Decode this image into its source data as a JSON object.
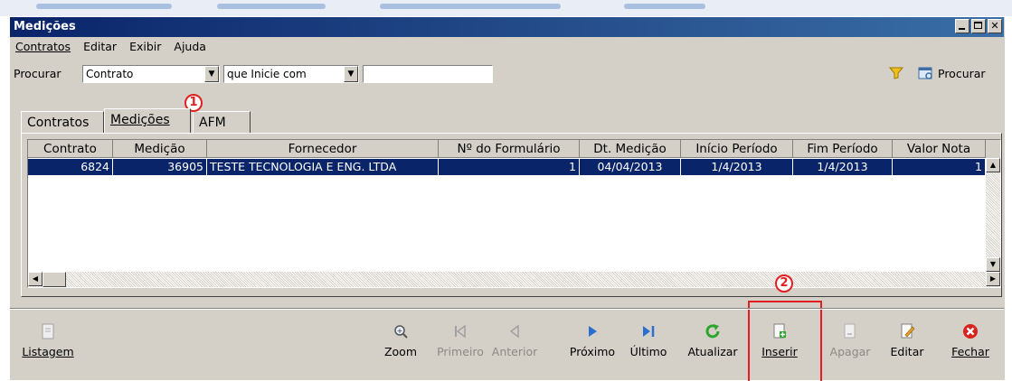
{
  "window": {
    "title": "Medições"
  },
  "menu": [
    {
      "label": "Contratos",
      "id": "menu-contratos"
    },
    {
      "label": "Editar",
      "id": "menu-editar"
    },
    {
      "label": "Exibir",
      "id": "menu-exibir"
    },
    {
      "label": "Ajuda",
      "id": "menu-ajuda"
    }
  ],
  "search": {
    "label": "Procurar",
    "field_value": "Contrato",
    "operator_value": "que Inicie com",
    "text_value": "",
    "button_label": "Procurar"
  },
  "tabs": [
    {
      "label": "Contratos"
    },
    {
      "label": "Medições"
    },
    {
      "label": "AFM"
    }
  ],
  "grid": {
    "columns": [
      "Contrato",
      "Medição",
      "Fornecedor",
      "Nº do Formulário",
      "Dt. Medição",
      "Início Período",
      "Fim Período",
      "Valor Nota"
    ],
    "rows": [
      [
        "6824",
        "36905",
        "TESTE TECNOLOGIA E ENG. LTDA",
        "1",
        "04/04/2013",
        "1/4/2013",
        "1/4/2013",
        "1"
      ]
    ]
  },
  "toolbar": {
    "listagem": "Listagem",
    "zoom": "Zoom",
    "primeiro": "Primeiro",
    "anterior": "Anterior",
    "proximo": "Próximo",
    "ultimo": "Último",
    "atualizar": "Atualizar",
    "inserir": "Inserir",
    "apagar": "Apagar",
    "editar": "Editar",
    "fechar": "Fechar"
  },
  "callouts": {
    "one": "1",
    "two": "2"
  },
  "colors": {
    "titlebar": "#0a246a",
    "selection": "#0a246a",
    "callout": "#e02020",
    "face": "#d4d0c8"
  }
}
